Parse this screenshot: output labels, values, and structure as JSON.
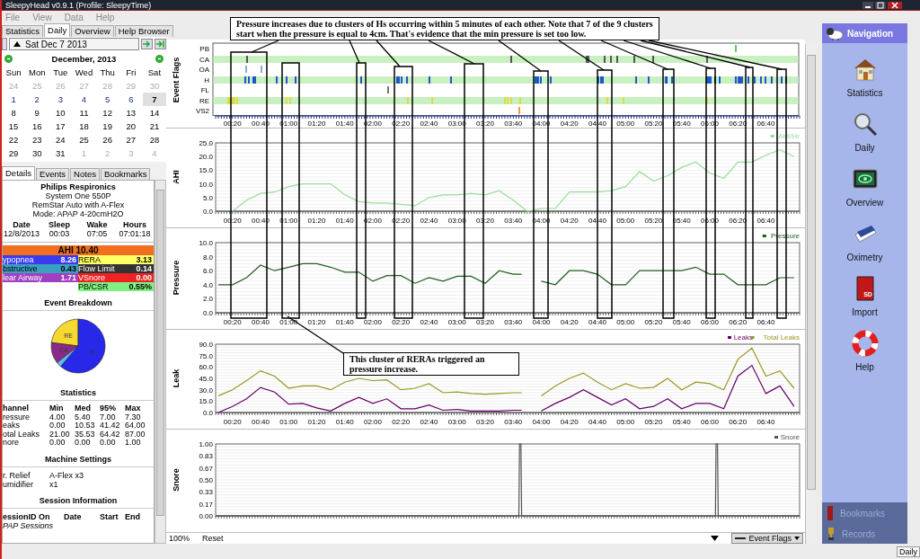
{
  "window": {
    "title": "SleepyHead v0.9.1  (Profile: SleepyTime)"
  },
  "menu": [
    "File",
    "View",
    "Data",
    "Help"
  ],
  "tabs": [
    {
      "label": "Statistics",
      "selected": false
    },
    {
      "label": "Daily",
      "selected": true
    },
    {
      "label": "Overview",
      "selected": false
    },
    {
      "label": "Help Browser",
      "selected": false
    }
  ],
  "date_picker": {
    "value": "Sat Dec 7 2013"
  },
  "calendar": {
    "title": "December,  2013",
    "day_names": [
      "Sun",
      "Mon",
      "Tue",
      "Wed",
      "Thu",
      "Fri",
      "Sat"
    ],
    "weeks": [
      [
        {
          "label": "24",
          "muted": true,
          "has_data": false,
          "selected": false
        },
        {
          "label": "25",
          "muted": true,
          "has_data": false,
          "selected": false
        },
        {
          "label": "26",
          "muted": true,
          "has_data": false,
          "selected": false
        },
        {
          "label": "27",
          "muted": true,
          "has_data": false,
          "selected": false
        },
        {
          "label": "28",
          "muted": true,
          "has_data": false,
          "selected": false
        },
        {
          "label": "29",
          "muted": true,
          "has_data": false,
          "selected": false
        },
        {
          "label": "30",
          "muted": true,
          "has_data": false,
          "selected": false
        }
      ],
      [
        {
          "label": "1",
          "muted": false,
          "has_data": true,
          "selected": false
        },
        {
          "label": "2",
          "muted": false,
          "has_data": true,
          "selected": false
        },
        {
          "label": "3",
          "muted": false,
          "has_data": true,
          "selected": false
        },
        {
          "label": "4",
          "muted": false,
          "has_data": true,
          "selected": false
        },
        {
          "label": "5",
          "muted": false,
          "has_data": true,
          "selected": false
        },
        {
          "label": "6",
          "muted": false,
          "has_data": true,
          "selected": false
        },
        {
          "label": "7",
          "muted": false,
          "has_data": false,
          "selected": true
        }
      ],
      [
        {
          "label": "8",
          "muted": false,
          "has_data": false,
          "selected": false
        },
        {
          "label": "9",
          "muted": false,
          "has_data": false,
          "selected": false
        },
        {
          "label": "10",
          "muted": false,
          "has_data": false,
          "selected": false
        },
        {
          "label": "11",
          "muted": false,
          "has_data": false,
          "selected": false
        },
        {
          "label": "12",
          "muted": false,
          "has_data": false,
          "selected": false
        },
        {
          "label": "13",
          "muted": false,
          "has_data": false,
          "selected": false
        },
        {
          "label": "14",
          "muted": false,
          "has_data": false,
          "selected": false
        }
      ],
      [
        {
          "label": "15",
          "muted": false,
          "has_data": false,
          "selected": false
        },
        {
          "label": "16",
          "muted": false,
          "has_data": false,
          "selected": false
        },
        {
          "label": "17",
          "muted": false,
          "has_data": false,
          "selected": false
        },
        {
          "label": "18",
          "muted": false,
          "has_data": false,
          "selected": false
        },
        {
          "label": "19",
          "muted": false,
          "has_data": false,
          "selected": false
        },
        {
          "label": "20",
          "muted": false,
          "has_data": false,
          "selected": false
        },
        {
          "label": "21",
          "muted": false,
          "has_data": false,
          "selected": false
        }
      ],
      [
        {
          "label": "22",
          "muted": false,
          "has_data": false,
          "selected": false
        },
        {
          "label": "23",
          "muted": false,
          "has_data": false,
          "selected": false
        },
        {
          "label": "24",
          "muted": false,
          "has_data": false,
          "selected": false
        },
        {
          "label": "25",
          "muted": false,
          "has_data": false,
          "selected": false
        },
        {
          "label": "26",
          "muted": false,
          "has_data": false,
          "selected": false
        },
        {
          "label": "27",
          "muted": false,
          "has_data": false,
          "selected": false
        },
        {
          "label": "28",
          "muted": false,
          "has_data": false,
          "selected": false
        }
      ],
      [
        {
          "label": "29",
          "muted": false,
          "has_data": false,
          "selected": false
        },
        {
          "label": "30",
          "muted": false,
          "has_data": false,
          "selected": false
        },
        {
          "label": "31",
          "muted": false,
          "has_data": false,
          "selected": false
        },
        {
          "label": "1",
          "muted": true,
          "has_data": false,
          "selected": false
        },
        {
          "label": "2",
          "muted": true,
          "has_data": false,
          "selected": false
        },
        {
          "label": "3",
          "muted": true,
          "has_data": false,
          "selected": false
        },
        {
          "label": "4",
          "muted": true,
          "has_data": false,
          "selected": false
        }
      ]
    ]
  },
  "detail_tabs": [
    {
      "label": "Details",
      "selected": true
    },
    {
      "label": "Events",
      "selected": false
    },
    {
      "label": "Notes",
      "selected": false
    },
    {
      "label": "Bookmarks",
      "selected": false
    }
  ],
  "details": {
    "device": [
      "Philips Respironics",
      "System One 550P",
      "RemStar Auto with A-Flex",
      "Mode: APAP 4-20cmH2O"
    ],
    "session_columns": [
      "Date",
      "Sleep",
      "Wake",
      "Hours"
    ],
    "session_values": [
      "12/8/2013",
      "00:03",
      "07:05",
      "07:01:18"
    ],
    "ahi": "AHI 10.40",
    "indices": [
      {
        "name": "ypopnea",
        "value": "8.26",
        "color": "#3a3af0"
      },
      {
        "name": "RERA",
        "value": "3.13",
        "color": "#ffff66"
      },
      {
        "name": "bstructive",
        "value": "0.43",
        "color": "#3aa0c0"
      },
      {
        "name": "Flow Limit",
        "value": "0.14",
        "color": "#333333"
      },
      {
        "name": "lear Airway",
        "value": "1.71",
        "color": "#a040c0"
      },
      {
        "name": "VSnore",
        "value": "0.00",
        "color": "#ee2222"
      },
      {
        "name": "PB/CSR",
        "value": "0.55%",
        "color": "#80f080"
      }
    ],
    "breakdown_title": "Event Breakdown",
    "pie": [
      {
        "label": "RE",
        "color": "#f5d830"
      },
      {
        "label": "CA",
        "color": "#8a2a8a"
      },
      {
        "color": "#60b8e8"
      },
      {
        "label": "H",
        "color": "#2828e8"
      }
    ],
    "statistics_title": "Statistics",
    "statistics_columns": [
      "hannel",
      "Min",
      "Med",
      "95%",
      "Max"
    ],
    "statistics_rows": [
      [
        "ressure",
        "4.00",
        "5.40",
        "7.00",
        "7.30"
      ],
      [
        "eaks",
        "0.00",
        "10.53",
        "41.42",
        "64.00"
      ],
      [
        "otal Leaks",
        "21.00",
        "35.53",
        "64.42",
        "87.00"
      ],
      [
        "nore",
        "0.00",
        "0.00",
        "0.00",
        "1.00"
      ]
    ],
    "settings_title": "Machine Settings",
    "settings": [
      [
        "r. Relief",
        "A-Flex x3"
      ],
      [
        "umidifier",
        "x1"
      ]
    ],
    "session_title": "Session Information",
    "session_info_columns": [
      "essionID",
      "On",
      "Date",
      "Start",
      "End"
    ],
    "session_info_note": "PAP Sessions"
  },
  "event_flags": {
    "ylabel": "Event Flags",
    "rows": [
      {
        "label": "PB",
        "color": "#66cc66"
      },
      {
        "label": "CA",
        "color": "#555555"
      },
      {
        "label": "OA",
        "color": "#88aadd"
      },
      {
        "label": "H",
        "color": "#2255cc"
      },
      {
        "label": "FL",
        "color": "#777777"
      },
      {
        "label": "RE",
        "color": "#dddd44"
      },
      {
        "label": "VS2",
        "color": "#ee9944"
      }
    ],
    "xticks": [
      "00:20",
      "00:40",
      "01:00",
      "01:20",
      "01:40",
      "02:00",
      "02:20",
      "02:40",
      "03:00",
      "03:20",
      "03:40",
      "04:00",
      "04:20",
      "04:40",
      "05:00",
      "05:20",
      "05:40",
      "06:00",
      "06:20",
      "06:40"
    ]
  },
  "charts": [
    {
      "chart_data": {
        "type": "line",
        "grid": true,
        "legend": "upper right",
        "ylabel": "AHI",
        "x": [
          20,
          30,
          40,
          50,
          60,
          70,
          80,
          90,
          100,
          110,
          120,
          130,
          140,
          150,
          160,
          170,
          180,
          190,
          200,
          210,
          220,
          230,
          240,
          250,
          260,
          270,
          280,
          290,
          300,
          310,
          320,
          330,
          340,
          350,
          360,
          370,
          380,
          390,
          400,
          410,
          420
        ],
        "xlim": [
          8,
          424
        ],
        "ylim": [
          0,
          25
        ],
        "yticks": [
          {
            "value": 0,
            "label": "0.0"
          },
          {
            "value": 5,
            "label": "5.0"
          },
          {
            "value": 10,
            "label": "10.0"
          },
          {
            "value": 15,
            "label": "15.0"
          },
          {
            "value": 20,
            "label": "20.0"
          },
          {
            "value": 25,
            "label": "25.0"
          }
        ],
        "xticks": [
          {
            "value": 20,
            "label": "00:20"
          },
          {
            "value": 40,
            "label": "00:40"
          },
          {
            "value": 60,
            "label": "01:00"
          },
          {
            "value": 80,
            "label": "01:20"
          },
          {
            "value": 100,
            "label": "01:40"
          },
          {
            "value": 120,
            "label": "02:00"
          },
          {
            "value": 140,
            "label": "02:20"
          },
          {
            "value": 160,
            "label": "02:40"
          },
          {
            "value": 180,
            "label": "03:00"
          },
          {
            "value": 200,
            "label": "03:20"
          },
          {
            "value": 220,
            "label": "03:40"
          },
          {
            "value": 240,
            "label": "04:00"
          },
          {
            "value": 260,
            "label": "04:20"
          },
          {
            "value": 280,
            "label": "04:40"
          },
          {
            "value": 300,
            "label": "05:00"
          },
          {
            "value": 320,
            "label": "05:20"
          },
          {
            "value": 340,
            "label": "05:40"
          },
          {
            "value": 360,
            "label": "06:00"
          },
          {
            "value": 380,
            "label": "06:20"
          },
          {
            "value": 400,
            "label": "06:40"
          }
        ],
        "series": [
          {
            "name": "AHI/Hr",
            "color": "#99dd99",
            "values": [
              0,
              4,
              6.5,
              7,
              9,
              10,
              10,
              10,
              6,
              3.5,
              3,
              3,
              2.5,
              2,
              5,
              6,
              6,
              6.5,
              6,
              7.5,
              4,
              0,
              1,
              1,
              7,
              7,
              7,
              7.5,
              9,
              14.5,
              11,
              13,
              16,
              18,
              14,
              12,
              18,
              18,
              20.5,
              22.5,
              20
            ]
          }
        ]
      }
    },
    {
      "chart_data": {
        "type": "line",
        "grid": true,
        "legend": "upper right",
        "ylabel": "Pressure",
        "x": [
          10,
          20,
          30,
          40,
          50,
          60,
          70,
          80,
          90,
          100,
          110,
          120,
          130,
          140,
          150,
          160,
          170,
          180,
          190,
          200,
          210,
          220,
          226,
          240,
          250,
          260,
          270,
          280,
          290,
          300,
          310,
          320,
          330,
          340,
          350,
          360,
          370,
          380,
          390,
          400,
          410,
          420
        ],
        "xlim": [
          8,
          424
        ],
        "ylim": [
          0,
          10
        ],
        "yticks": [
          {
            "value": 0,
            "label": "0.0"
          },
          {
            "value": 2,
            "label": "2.0"
          },
          {
            "value": 4,
            "label": "4.0"
          },
          {
            "value": 6,
            "label": "6.0"
          },
          {
            "value": 8,
            "label": "8.0"
          },
          {
            "value": 10,
            "label": "10.0"
          }
        ],
        "xticks": [
          {
            "value": 20,
            "label": "00:20"
          },
          {
            "value": 40,
            "label": "00:40"
          },
          {
            "value": 60,
            "label": "01:00"
          },
          {
            "value": 80,
            "label": "01:20"
          },
          {
            "value": 100,
            "label": "01:40"
          },
          {
            "value": 120,
            "label": "02:00"
          },
          {
            "value": 140,
            "label": "02:20"
          },
          {
            "value": 160,
            "label": "02:40"
          },
          {
            "value": 180,
            "label": "03:00"
          },
          {
            "value": 200,
            "label": "03:20"
          },
          {
            "value": 220,
            "label": "03:40"
          },
          {
            "value": 240,
            "label": "04:00"
          },
          {
            "value": 260,
            "label": "04:20"
          },
          {
            "value": 280,
            "label": "04:40"
          },
          {
            "value": 300,
            "label": "05:00"
          },
          {
            "value": 320,
            "label": "05:20"
          },
          {
            "value": 340,
            "label": "05:40"
          },
          {
            "value": 360,
            "label": "06:00"
          },
          {
            "value": 380,
            "label": "06:20"
          },
          {
            "value": 400,
            "label": "06:40"
          }
        ],
        "series": [
          {
            "name": "Pressure",
            "color": "#1e5e1e",
            "values": [
              4,
              4,
              5,
              6.8,
              6,
              6.5,
              7,
              7,
              6.5,
              5.8,
              5.8,
              4.5,
              5.3,
              5.3,
              4.2,
              5,
              4.5,
              5.2,
              5.2,
              4.2,
              6,
              5.5,
              null,
              4.5,
              4,
              6,
              6,
              5.5,
              4,
              4,
              6,
              6,
              6,
              6,
              6.5,
              5.5,
              5.5,
              4,
              4,
              4,
              5,
              5
            ]
          }
        ]
      }
    },
    {
      "chart_data": {
        "type": "line",
        "grid": true,
        "legend": "upper right",
        "ylabel": "Leak",
        "x": [
          10,
          20,
          30,
          40,
          50,
          60,
          70,
          80,
          90,
          100,
          110,
          120,
          130,
          140,
          150,
          160,
          170,
          180,
          190,
          200,
          210,
          220,
          226,
          240,
          250,
          260,
          270,
          280,
          290,
          300,
          310,
          320,
          330,
          340,
          350,
          360,
          370,
          380,
          390,
          400,
          410,
          420
        ],
        "xlim": [
          8,
          424
        ],
        "ylim": [
          0,
          90
        ],
        "yticks": [
          {
            "value": 0,
            "label": "0.0"
          },
          {
            "value": 15,
            "label": "15.0"
          },
          {
            "value": 30,
            "label": "30.0"
          },
          {
            "value": 45,
            "label": "45.0"
          },
          {
            "value": 60,
            "label": "60.0"
          },
          {
            "value": 75,
            "label": "75.0"
          },
          {
            "value": 90,
            "label": "90.0"
          }
        ],
        "xticks": [
          {
            "value": 20,
            "label": "00:20"
          },
          {
            "value": 40,
            "label": "00:40"
          },
          {
            "value": 60,
            "label": "01:00"
          },
          {
            "value": 80,
            "label": "01:20"
          },
          {
            "value": 100,
            "label": "01:40"
          },
          {
            "value": 120,
            "label": "02:00"
          },
          {
            "value": 140,
            "label": "02:20"
          },
          {
            "value": 160,
            "label": "02:40"
          },
          {
            "value": 180,
            "label": "03:00"
          },
          {
            "value": 200,
            "label": "03:20"
          },
          {
            "value": 220,
            "label": "03:40"
          },
          {
            "value": 240,
            "label": "04:00"
          },
          {
            "value": 260,
            "label": "04:20"
          },
          {
            "value": 280,
            "label": "04:40"
          },
          {
            "value": 300,
            "label": "05:00"
          },
          {
            "value": 320,
            "label": "05:20"
          },
          {
            "value": 340,
            "label": "05:40"
          },
          {
            "value": 360,
            "label": "06:00"
          },
          {
            "value": 380,
            "label": "06:20"
          },
          {
            "value": 400,
            "label": "06:40"
          }
        ],
        "series": [
          {
            "name": "Leaks",
            "color": "#660066",
            "values": [
              0,
              8,
              18,
              33,
              27,
              11,
              12,
              6,
              2,
              12,
              20,
              12,
              18,
              5,
              5,
              10,
              3,
              4,
              2,
              2,
              2,
              3,
              null,
              2,
              12,
              20,
              30,
              20,
              10,
              18,
              5,
              8,
              18,
              5,
              12,
              12,
              5,
              48,
              62,
              25,
              35,
              8
            ]
          },
          {
            "name": "Total Leaks",
            "color": "#999922",
            "values": [
              22,
              30,
              42,
              55,
              48,
              32,
              35,
              35,
              30,
              40,
              45,
              42,
              43,
              30,
              32,
              38,
              26,
              27,
              25,
              24,
              25,
              26,
              null,
              22,
              35,
              45,
              52,
              40,
              30,
              38,
              32,
              33,
              45,
              30,
              40,
              38,
              30,
              70,
              85,
              48,
              55,
              32
            ]
          }
        ]
      }
    },
    {
      "chart_data": {
        "type": "line",
        "grid": true,
        "legend": "upper right",
        "ylabel": "Snore",
        "x": [
          8,
          224,
          224.5,
          225.5,
          226,
          364,
          364.5,
          365.5,
          366,
          424
        ],
        "xlim": [
          8,
          424
        ],
        "ylim": [
          0,
          1
        ],
        "yticks": [
          {
            "value": 0,
            "label": "0.00"
          },
          {
            "value": 0.1667,
            "label": "0.17"
          },
          {
            "value": 0.3333,
            "label": "0.33"
          },
          {
            "value": 0.5,
            "label": "0.50"
          },
          {
            "value": 0.6667,
            "label": "0.67"
          },
          {
            "value": 0.8333,
            "label": "0.83"
          },
          {
            "value": 1,
            "label": "1.00"
          }
        ],
        "series": [
          {
            "name": "Snore",
            "color": "#555555",
            "values": [
              0,
              0,
              1,
              1,
              0,
              0,
              1,
              1,
              0,
              0
            ]
          }
        ]
      }
    }
  ],
  "chart_footer": {
    "zoom": "100%",
    "reset": "Reset",
    "flags_select": "Event Flags"
  },
  "annotations": [
    {
      "text": "Pressure increases due to clusters of Hs occurring within 5 minutes of each other.  Note that 7 of the 9 clusters start when the pressure is equal to 4cm.   That's evidence that the  min pressure is set too low."
    },
    {
      "text": "This cluster of RERAs triggered an pressure increase."
    }
  ],
  "navigation": {
    "title": "Navigation",
    "items": [
      {
        "label": "Statistics"
      },
      {
        "label": "Daily"
      },
      {
        "label": "Overview"
      },
      {
        "label": "Oximetry"
      },
      {
        "label": "Import",
        "icon_text": "SD"
      },
      {
        "label": "Help"
      }
    ],
    "bottom": [
      {
        "label": "Bookmarks"
      },
      {
        "label": "Records"
      }
    ]
  },
  "status_bar": {
    "text": "Daily"
  }
}
